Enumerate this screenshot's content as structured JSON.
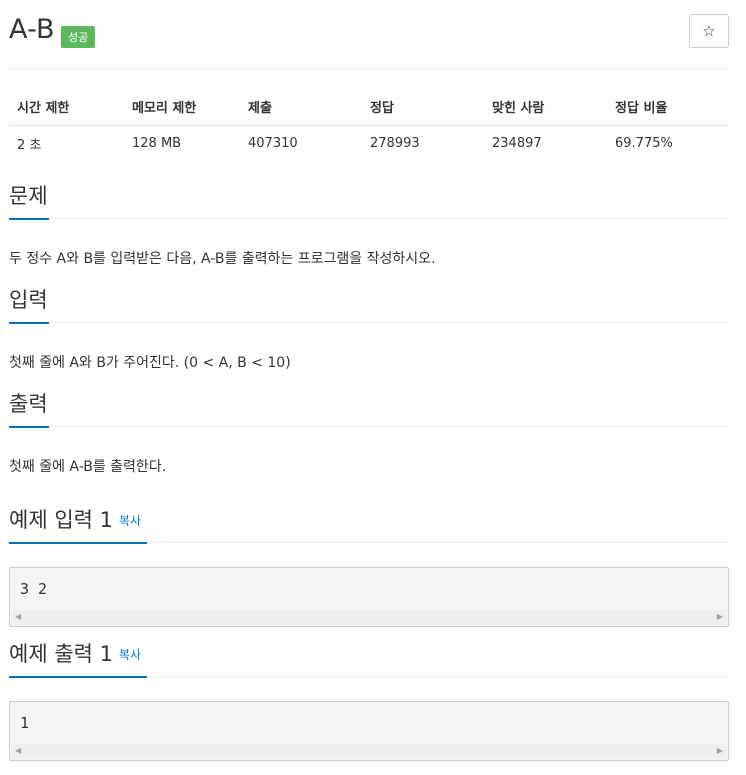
{
  "header": {
    "title": "A-B",
    "badge": "성공",
    "star_icon": "☆"
  },
  "info_table": {
    "headers": [
      "시간 제한",
      "메모리 제한",
      "제출",
      "정답",
      "맞힌 사람",
      "정답 비율"
    ],
    "values": [
      "2 초",
      "128 MB",
      "407310",
      "278993",
      "234897",
      "69.775%"
    ]
  },
  "problem": {
    "title": "문제",
    "text": "두 정수 A와 B를 입력받은 다음, A-B를 출력하는 프로그램을 작성하시오."
  },
  "input": {
    "title": "입력",
    "text": "첫째 줄에 A와 B가 주어진다. (0 < A, B < 10)"
  },
  "output": {
    "title": "출력",
    "text": "첫째 줄에 A-B를 출력한다."
  },
  "sample_input": {
    "title": "예제 입력 1",
    "copy_label": "복사",
    "content": "3 2"
  },
  "sample_output": {
    "title": "예제 출력 1",
    "copy_label": "복사",
    "content": "1"
  },
  "scroll": {
    "left_arrow": "◀",
    "right_arrow": "▶"
  },
  "colors": {
    "accent": "#0076c0",
    "success_badge": "#5cb85c"
  }
}
